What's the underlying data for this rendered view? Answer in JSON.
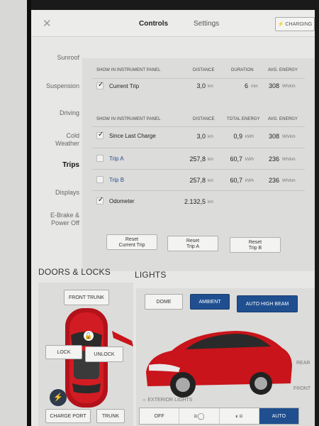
{
  "header": {
    "close_icon": "close-icon",
    "tabs": [
      {
        "label": "Controls",
        "active": true
      },
      {
        "label": "Settings",
        "active": false
      }
    ],
    "charging_label": "CHARGING"
  },
  "sidebar": {
    "items": [
      {
        "label": "Sunroof"
      },
      {
        "label": "Suspension"
      },
      {
        "label": "Driving"
      },
      {
        "label": "Cold Weather"
      },
      {
        "label": "Trips",
        "active": true
      },
      {
        "label": "Displays"
      },
      {
        "label": "E-Brake & Power Off"
      }
    ]
  },
  "trips": {
    "current": {
      "header": {
        "show": "SHOW IN INSTRUMENT PANEL",
        "distance": "DISTANCE",
        "duration": "DURATION",
        "avg_energy": "AVG. ENERGY"
      },
      "row": {
        "label": "Current Trip",
        "checked": true,
        "distance": "3,0",
        "distance_unit": "km",
        "duration": "6",
        "duration_unit": "min",
        "avg_energy": "308",
        "avg_energy_unit": "Wh/km"
      }
    },
    "totals": {
      "header": {
        "show": "SHOW IN INSTRUMENT PANEL",
        "distance": "DISTANCE",
        "total_energy": "TOTAL ENERGY",
        "avg_energy": "AVG. ENERGY"
      },
      "rows": [
        {
          "label": "Since Last Charge",
          "checked": true,
          "distance": "3,0",
          "distance_unit": "km",
          "total_energy": "0,9",
          "total_energy_unit": "kWh",
          "avg_energy": "308",
          "avg_energy_unit": "Wh/km"
        },
        {
          "label": "Trip A",
          "checked": false,
          "distance": "257,8",
          "distance_unit": "km",
          "total_energy": "60,7",
          "total_energy_unit": "kWh",
          "avg_energy": "236",
          "avg_energy_unit": "Wh/km"
        },
        {
          "label": "Trip B",
          "checked": false,
          "distance": "257,8",
          "distance_unit": "km",
          "total_energy": "60,7",
          "total_energy_unit": "kWh",
          "avg_energy": "236",
          "avg_energy_unit": "Wh/km"
        },
        {
          "label": "Odometer",
          "checked": true,
          "distance": "2.132,5",
          "distance_unit": "km"
        }
      ]
    },
    "reset_buttons": [
      {
        "line1": "Reset",
        "line2": "Current Trip"
      },
      {
        "line1": "Reset",
        "line2": "Trip A"
      },
      {
        "line1": "Reset",
        "line2": "Trip B"
      }
    ]
  },
  "doors": {
    "title": "DOORS & LOCKS",
    "front_trunk": "FRONT TRUNK",
    "lock": "LOCK",
    "unlock": "UNLOCK",
    "charge_port": "CHARGE PORT",
    "trunk": "TRUNK"
  },
  "lights": {
    "title": "LIGHTS",
    "dome": "DOME",
    "ambient": "AMBIENT",
    "auto_high_beam": "AUTO HIGH BEAM",
    "exterior_lights": "EXTERIOR LIGHTS",
    "rear": "REAR",
    "front": "FRONT",
    "off": "OFF",
    "auto": "AUTO"
  },
  "colors": {
    "accent": "#1f4f8f",
    "car_red": "#c8141a"
  }
}
